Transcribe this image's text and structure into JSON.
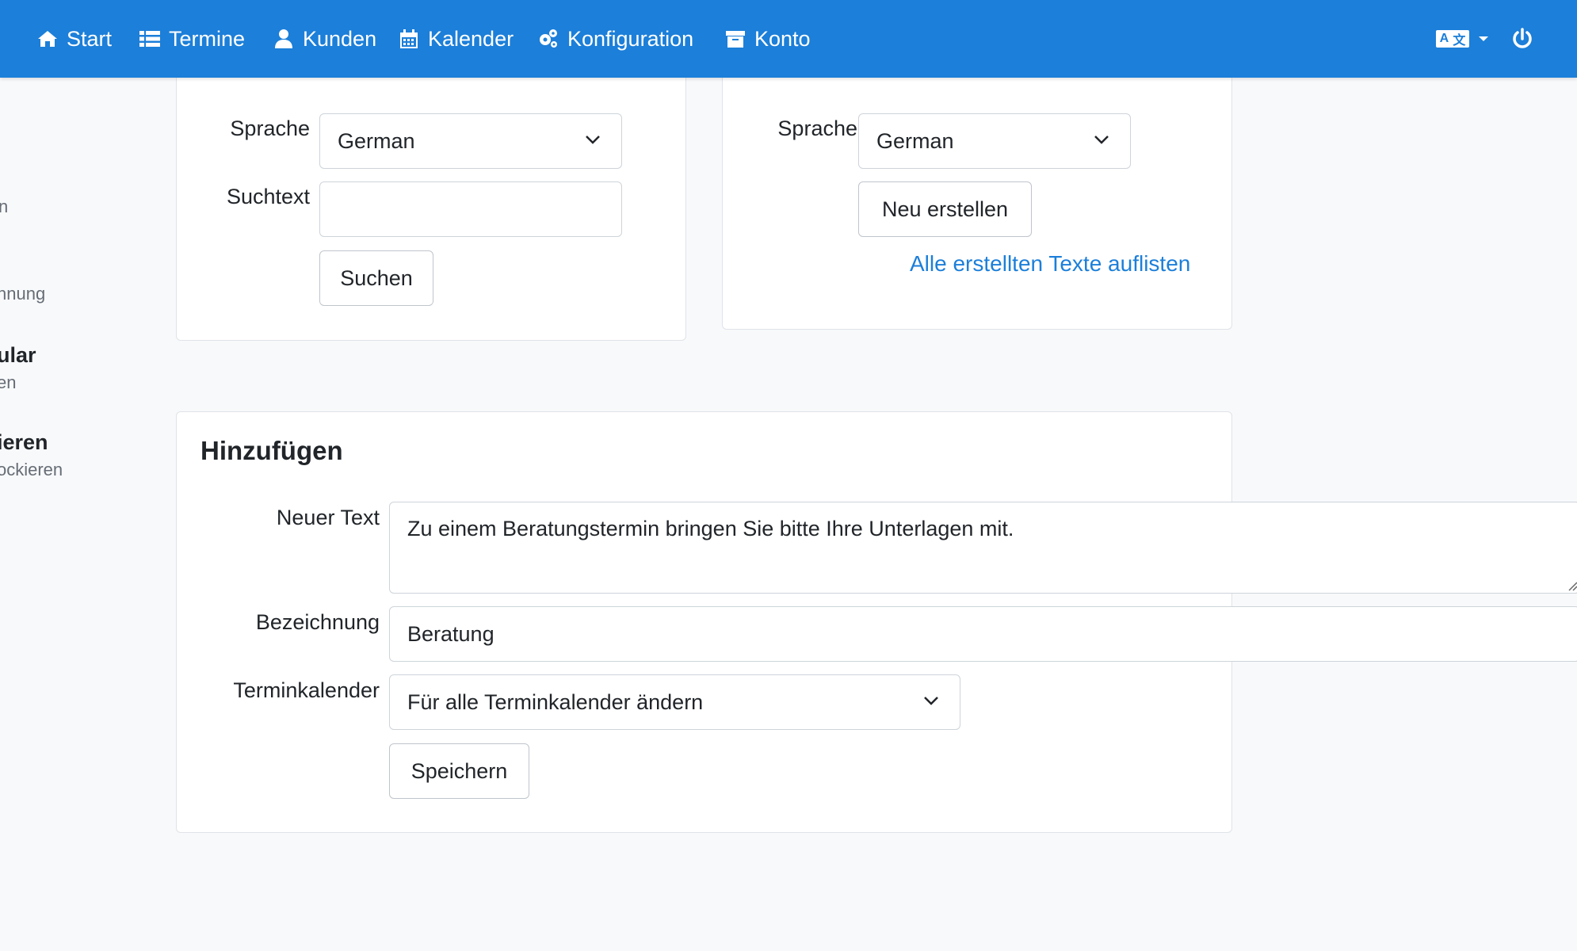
{
  "nav": {
    "items": [
      {
        "label": "Start",
        "icon": "home-icon"
      },
      {
        "label": "Termine",
        "icon": "list-icon"
      },
      {
        "label": "Kunden",
        "icon": "user-icon"
      },
      {
        "label": "Kalender",
        "icon": "calendar-icon"
      },
      {
        "label": "Konfiguration",
        "icon": "gears-icon"
      },
      {
        "label": "Konto",
        "icon": "archive-icon"
      }
    ],
    "language_icon": {
      "left": "A",
      "right": "文"
    },
    "power_icon": "power-icon"
  },
  "sidebar": {
    "fragments": [
      "n",
      "hnung",
      "ular",
      "en",
      "ieren",
      "ockieren"
    ]
  },
  "search_card": {
    "language_label": "Sprache",
    "language_value": "German",
    "search_label": "Suchtext",
    "search_value": "",
    "search_button": "Suchen"
  },
  "create_card": {
    "language_label": "Sprache",
    "language_value": "German",
    "create_button": "Neu erstellen",
    "list_link": "Alle erstellten Texte auflisten"
  },
  "add_card": {
    "title": "Hinzufügen",
    "text_label": "Neuer Text",
    "text_value": "Zu einem Beratungstermin bringen Sie bitte Ihre Unterlagen mit.",
    "name_label": "Bezeichnung",
    "name_value": "Beratung",
    "calendar_label": "Terminkalender",
    "calendar_value": "Für alle Terminkalender ändern",
    "save_button": "Speichern"
  },
  "colors": {
    "navbar": "#1c7fd9",
    "link": "#1c7fd9",
    "background": "#f8f9fb"
  }
}
